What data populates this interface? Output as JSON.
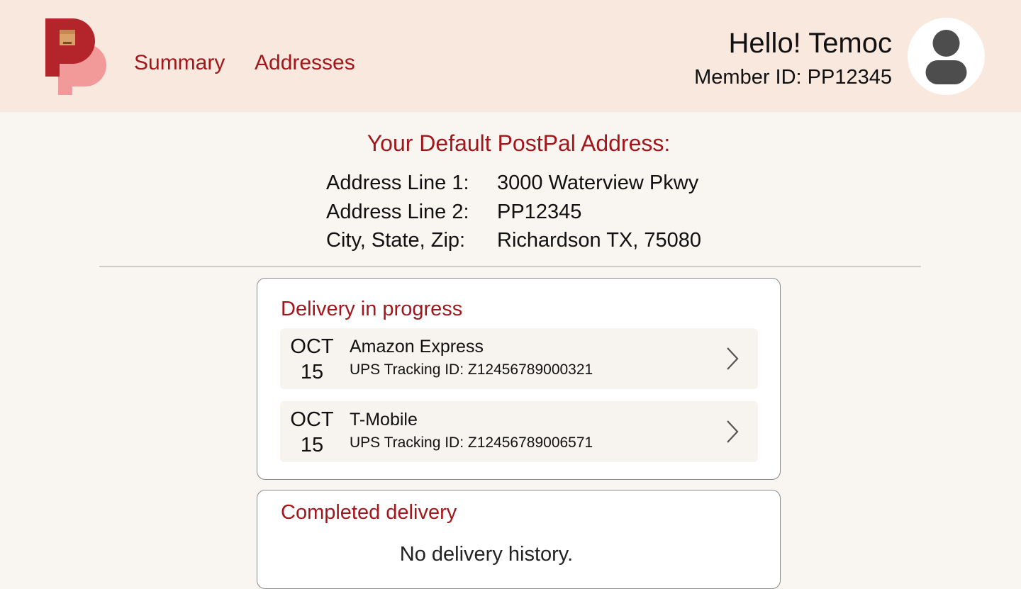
{
  "app": {
    "logo_icon": "postpal-logo-icon",
    "brand_color": "#a3161c"
  },
  "nav": {
    "summary_label": "Summary",
    "addresses_label": "Addresses"
  },
  "user": {
    "greeting": "Hello! Temoc",
    "member_id": "Member ID: PP12345",
    "avatar_icon": "user-avatar-icon"
  },
  "address": {
    "title": "Your Default PostPal Address:",
    "rows": [
      {
        "label": "Address Line 1:",
        "value": "3000 Waterview Pkwy"
      },
      {
        "label": "Address Line 2:",
        "value": "PP12345"
      },
      {
        "label": "City, State, Zip:",
        "value": "Richardson TX, 75080"
      }
    ]
  },
  "in_progress": {
    "title": "Delivery in progress",
    "items": [
      {
        "month": "OCT",
        "day": "15",
        "title": "Amazon Express",
        "tracking": "UPS Tracking ID: Z12456789000321",
        "icon": "chevron-right-icon"
      },
      {
        "month": "OCT",
        "day": "15",
        "title": "T-Mobile",
        "tracking": "UPS Tracking ID: Z12456789006571",
        "icon": "chevron-right-icon"
      }
    ]
  },
  "completed": {
    "title": "Completed delivery",
    "empty_text": "No delivery history."
  }
}
